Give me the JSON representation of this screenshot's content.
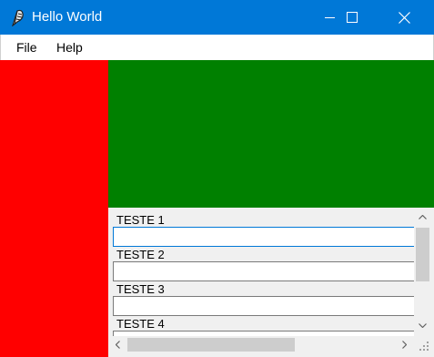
{
  "window": {
    "title": "Hello World",
    "icon": "feather-icon",
    "controls": [
      "minimize-icon",
      "maximize-icon",
      "close-icon"
    ]
  },
  "menu": {
    "file": "File",
    "help": "Help"
  },
  "panels": {
    "left_color": "#ff0000",
    "top_color": "#008000"
  },
  "form": {
    "fields": [
      {
        "label": "TESTE 1",
        "value": ""
      },
      {
        "label": "TESTE 2",
        "value": ""
      },
      {
        "label": "TESTE 3",
        "value": ""
      },
      {
        "label": "TESTE 4",
        "value": ""
      }
    ]
  },
  "colors": {
    "titlebar": "#0078d7",
    "form_background": "#f0f0f0",
    "focus_border": "#0078d7"
  }
}
